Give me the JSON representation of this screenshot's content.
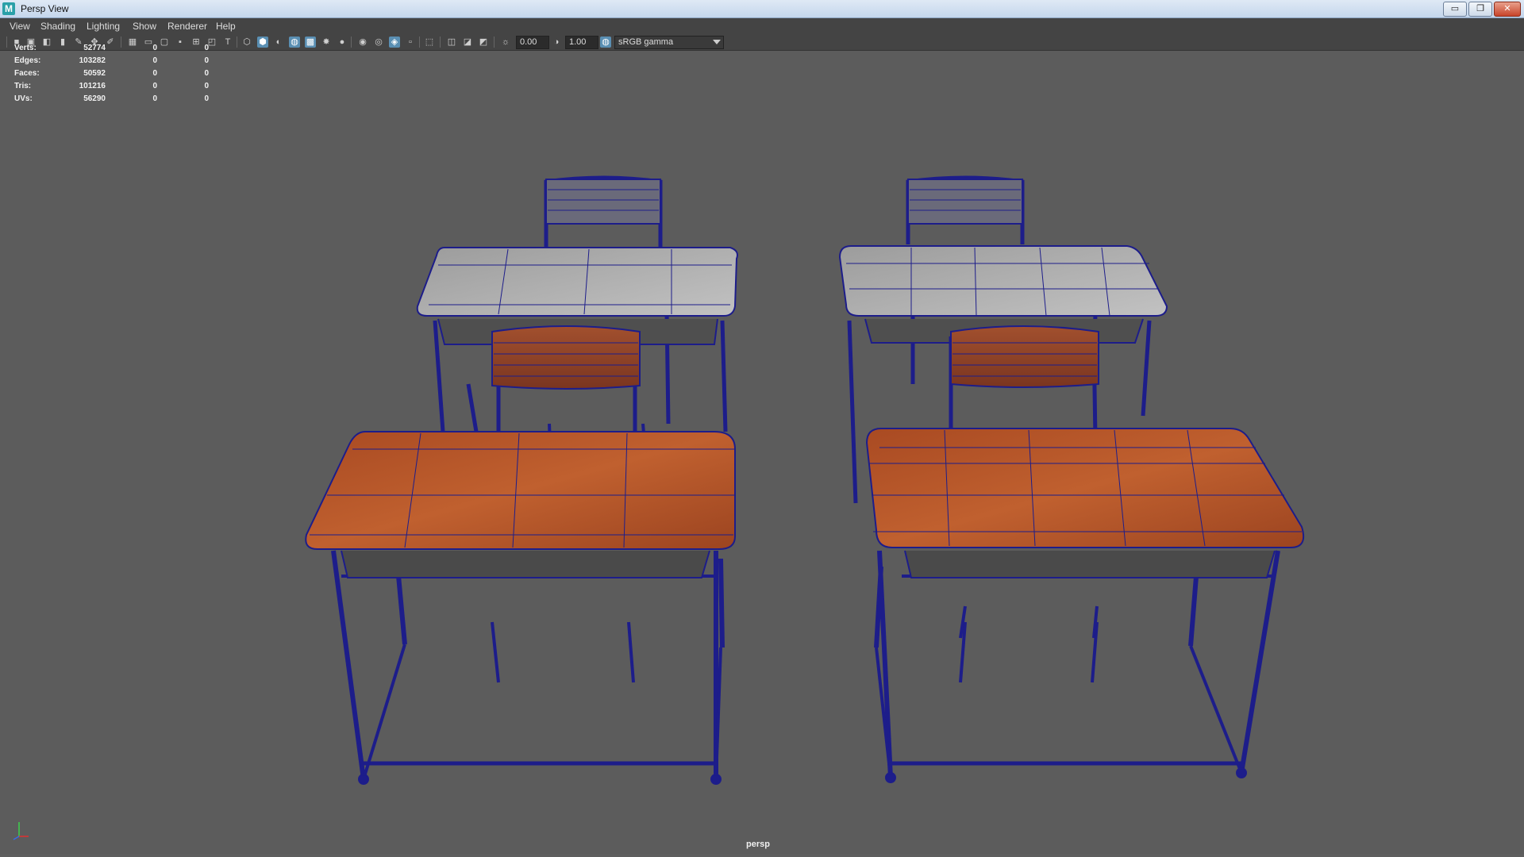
{
  "window": {
    "title": "Persp View",
    "app_icon_letter": "M",
    "controls": {
      "minimize": "▭",
      "restore": "❐",
      "close": "✕"
    }
  },
  "menu": {
    "items": [
      "View",
      "Shading",
      "Lighting",
      "Show",
      "Renderer",
      "Help"
    ]
  },
  "toolbar": {
    "exposure_value": "0.00",
    "gamma_value": "1.00",
    "colorspace": "sRGB gamma"
  },
  "hud": {
    "rows": [
      {
        "label": "Verts:",
        "values": [
          "52774",
          "0",
          "0"
        ]
      },
      {
        "label": "Edges:",
        "values": [
          "103282",
          "0",
          "0"
        ]
      },
      {
        "label": "Faces:",
        "values": [
          "50592",
          "0",
          "0"
        ]
      },
      {
        "label": "Tris:",
        "values": [
          "101216",
          "0",
          "0"
        ]
      },
      {
        "label": "UVs:",
        "values": [
          "56290",
          "0",
          "0"
        ]
      }
    ]
  },
  "viewport": {
    "camera_label": "persp",
    "colors": {
      "background": "#5c5c5c",
      "wireframe": "#1d1d8a",
      "wood": "#b5552a",
      "gray_top": "#b8b8b8"
    }
  }
}
